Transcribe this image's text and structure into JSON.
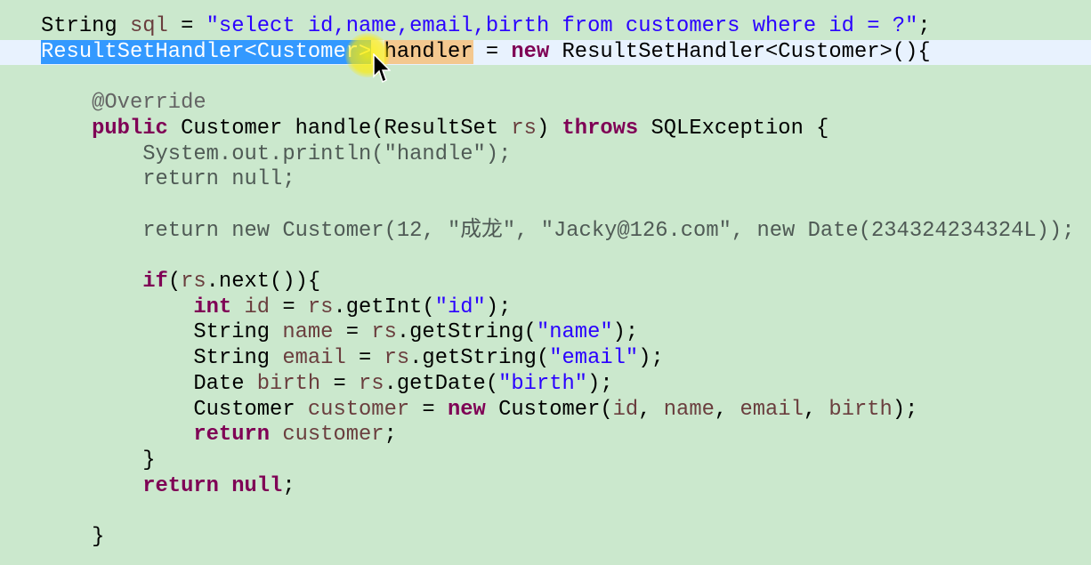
{
  "editor": {
    "lines": [
      {
        "tokens": [
          {
            "t": "String ",
            "c": "plain"
          },
          {
            "t": "sql",
            "c": "var"
          },
          {
            "t": " = ",
            "c": "plain"
          },
          {
            "t": "\"select id,name,email,birth from customers where id = ?\"",
            "c": "str"
          },
          {
            "t": ";",
            "c": "plain"
          }
        ]
      },
      {
        "current": true,
        "tokens": [
          {
            "t": "ResultSetHandler<Customer>",
            "c": "sel"
          },
          {
            "t": " ",
            "c": "plain"
          },
          {
            "t": "handler",
            "c": "occ"
          },
          {
            "t": " = ",
            "c": "plain"
          },
          {
            "t": "new",
            "c": "kw"
          },
          {
            "t": " ResultSetHandler<Customer>(){",
            "c": "plain"
          }
        ]
      },
      {
        "tokens": []
      },
      {
        "tokens": [
          {
            "t": "    ",
            "c": "plain"
          },
          {
            "t": "@Override",
            "c": "ann"
          }
        ]
      },
      {
        "tokens": [
          {
            "t": "    ",
            "c": "plain"
          },
          {
            "t": "public",
            "c": "kw"
          },
          {
            "t": " Customer handle(ResultSet ",
            "c": "plain"
          },
          {
            "t": "rs",
            "c": "var"
          },
          {
            "t": ") ",
            "c": "plain"
          },
          {
            "t": "throws",
            "c": "kw"
          },
          {
            "t": " SQLException {",
            "c": "plain"
          }
        ]
      },
      {
        "tokens": [
          {
            "t": "        ",
            "c": "plain"
          },
          {
            "t": "System.out.println(\"handle\");",
            "c": "dead"
          }
        ]
      },
      {
        "tokens": [
          {
            "t": "        ",
            "c": "plain"
          },
          {
            "t": "return null;",
            "c": "dead"
          }
        ]
      },
      {
        "tokens": []
      },
      {
        "tokens": [
          {
            "t": "        ",
            "c": "plain"
          },
          {
            "t": "return new Customer(12, \"成龙\", \"Jacky@126.com\", new Date(234324234324L));",
            "c": "dead"
          }
        ]
      },
      {
        "tokens": []
      },
      {
        "tokens": [
          {
            "t": "        ",
            "c": "plain"
          },
          {
            "t": "if",
            "c": "kw"
          },
          {
            "t": "(",
            "c": "plain"
          },
          {
            "t": "rs",
            "c": "var"
          },
          {
            "t": ".next()){",
            "c": "plain"
          }
        ]
      },
      {
        "tokens": [
          {
            "t": "            ",
            "c": "plain"
          },
          {
            "t": "int",
            "c": "kw"
          },
          {
            "t": " ",
            "c": "plain"
          },
          {
            "t": "id",
            "c": "var"
          },
          {
            "t": " = ",
            "c": "plain"
          },
          {
            "t": "rs",
            "c": "var"
          },
          {
            "t": ".getInt(",
            "c": "plain"
          },
          {
            "t": "\"id\"",
            "c": "str"
          },
          {
            "t": ");",
            "c": "plain"
          }
        ]
      },
      {
        "tokens": [
          {
            "t": "            String ",
            "c": "plain"
          },
          {
            "t": "name",
            "c": "var"
          },
          {
            "t": " = ",
            "c": "plain"
          },
          {
            "t": "rs",
            "c": "var"
          },
          {
            "t": ".getString(",
            "c": "plain"
          },
          {
            "t": "\"name\"",
            "c": "str"
          },
          {
            "t": ");",
            "c": "plain"
          }
        ]
      },
      {
        "tokens": [
          {
            "t": "            String ",
            "c": "plain"
          },
          {
            "t": "email",
            "c": "var"
          },
          {
            "t": " = ",
            "c": "plain"
          },
          {
            "t": "rs",
            "c": "var"
          },
          {
            "t": ".getString(",
            "c": "plain"
          },
          {
            "t": "\"email\"",
            "c": "str"
          },
          {
            "t": ");",
            "c": "plain"
          }
        ]
      },
      {
        "tokens": [
          {
            "t": "            Date ",
            "c": "plain"
          },
          {
            "t": "birth",
            "c": "var"
          },
          {
            "t": " = ",
            "c": "plain"
          },
          {
            "t": "rs",
            "c": "var"
          },
          {
            "t": ".getDate(",
            "c": "plain"
          },
          {
            "t": "\"birth\"",
            "c": "str"
          },
          {
            "t": ");",
            "c": "plain"
          }
        ]
      },
      {
        "tokens": [
          {
            "t": "            Customer ",
            "c": "plain"
          },
          {
            "t": "customer",
            "c": "var"
          },
          {
            "t": " = ",
            "c": "plain"
          },
          {
            "t": "new",
            "c": "kw"
          },
          {
            "t": " Customer(",
            "c": "plain"
          },
          {
            "t": "id",
            "c": "var"
          },
          {
            "t": ", ",
            "c": "plain"
          },
          {
            "t": "name",
            "c": "var"
          },
          {
            "t": ", ",
            "c": "plain"
          },
          {
            "t": "email",
            "c": "var"
          },
          {
            "t": ", ",
            "c": "plain"
          },
          {
            "t": "birth",
            "c": "var"
          },
          {
            "t": ");",
            "c": "plain"
          }
        ]
      },
      {
        "tokens": [
          {
            "t": "            ",
            "c": "plain"
          },
          {
            "t": "return",
            "c": "kw"
          },
          {
            "t": " ",
            "c": "plain"
          },
          {
            "t": "customer",
            "c": "var"
          },
          {
            "t": ";",
            "c": "plain"
          }
        ]
      },
      {
        "tokens": [
          {
            "t": "        }",
            "c": "plain"
          }
        ]
      },
      {
        "tokens": [
          {
            "t": "        ",
            "c": "plain"
          },
          {
            "t": "return",
            "c": "kw"
          },
          {
            "t": " ",
            "c": "plain"
          },
          {
            "t": "null",
            "c": "kw"
          },
          {
            "t": ";",
            "c": "plain"
          }
        ]
      },
      {
        "tokens": []
      },
      {
        "tokens": [
          {
            "t": "    }",
            "c": "plain"
          }
        ]
      }
    ]
  }
}
